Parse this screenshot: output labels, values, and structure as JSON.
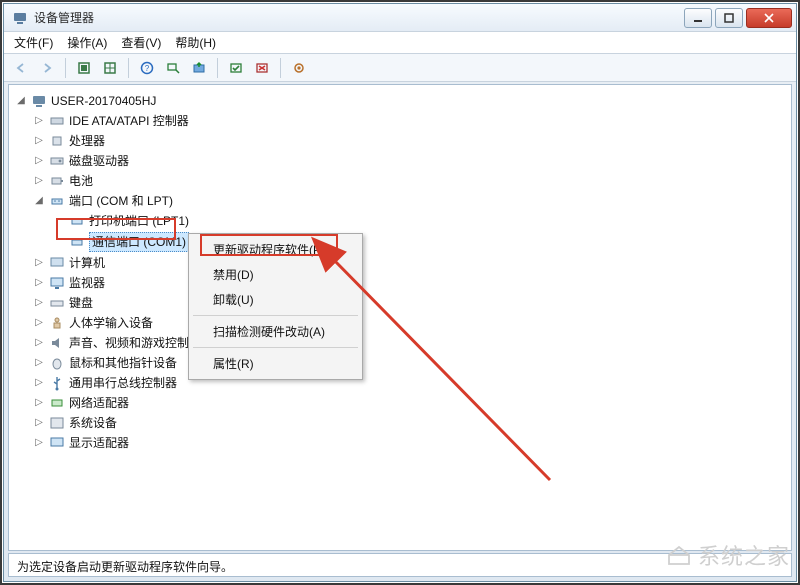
{
  "window": {
    "title": "设备管理器"
  },
  "menus": {
    "file": "文件(F)",
    "action": "操作(A)",
    "view": "查看(V)",
    "help": "帮助(H)"
  },
  "tree": {
    "root": "USER-20170405HJ",
    "ide": "IDE ATA/ATAPI 控制器",
    "cpu": "处理器",
    "disk": "磁盘驱动器",
    "batt": "电池",
    "ports": "端口 (COM 和 LPT)",
    "lpt1": "打印机端口 (LPT1)",
    "com": "通信端口 (COM1)",
    "pc": "计算机",
    "mon": "监视器",
    "kb": "键盘",
    "hid": "人体学输入设备",
    "snd": "声音、视频和游戏控制器",
    "mouse": "鼠标和其他指针设备",
    "usb": "通用串行总线控制器",
    "net": "网络适配器",
    "sys": "系统设备",
    "disp": "显示适配器"
  },
  "ctx": {
    "update": "更新驱动程序软件(P)...",
    "disable": "禁用(D)",
    "uninstall": "卸载(U)",
    "scan": "扫描检测硬件改动(A)",
    "props": "属性(R)"
  },
  "status": "为选定设备启动更新驱动程序软件向导。",
  "watermark": "系统之家"
}
